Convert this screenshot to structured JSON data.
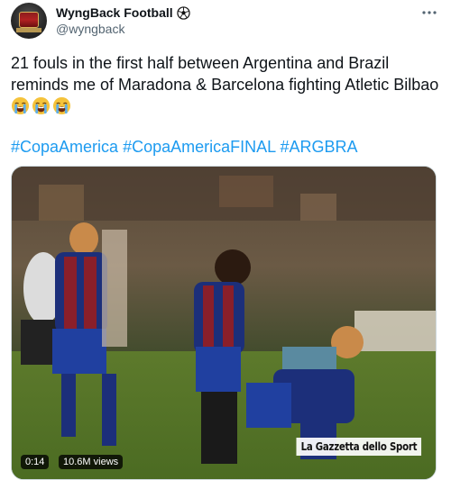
{
  "author": {
    "display_name": "WyngBack Football",
    "handle": "@wyngback",
    "badge_icon": "soccer-ball-icon"
  },
  "tweet": {
    "text": "21 fouls in the first half between Argentina and Brazil reminds me of Maradona & Barcelona fighting Atletic Bilbao",
    "emoji": [
      "loudly-crying-face-icon",
      "loudly-crying-face-icon",
      "loudly-crying-face-icon"
    ],
    "hashtags": [
      "#CopaAmerica",
      "#CopaAmericaFINAL",
      "#ARGBRA"
    ]
  },
  "media": {
    "type": "video",
    "duration": "0:14",
    "views": "10.6M views",
    "watermark": "La Gazzetta dello Sport"
  },
  "colors": {
    "link": "#1d9bf0",
    "text": "#0f1419",
    "secondary": "#536471",
    "border": "#cfd9de"
  }
}
